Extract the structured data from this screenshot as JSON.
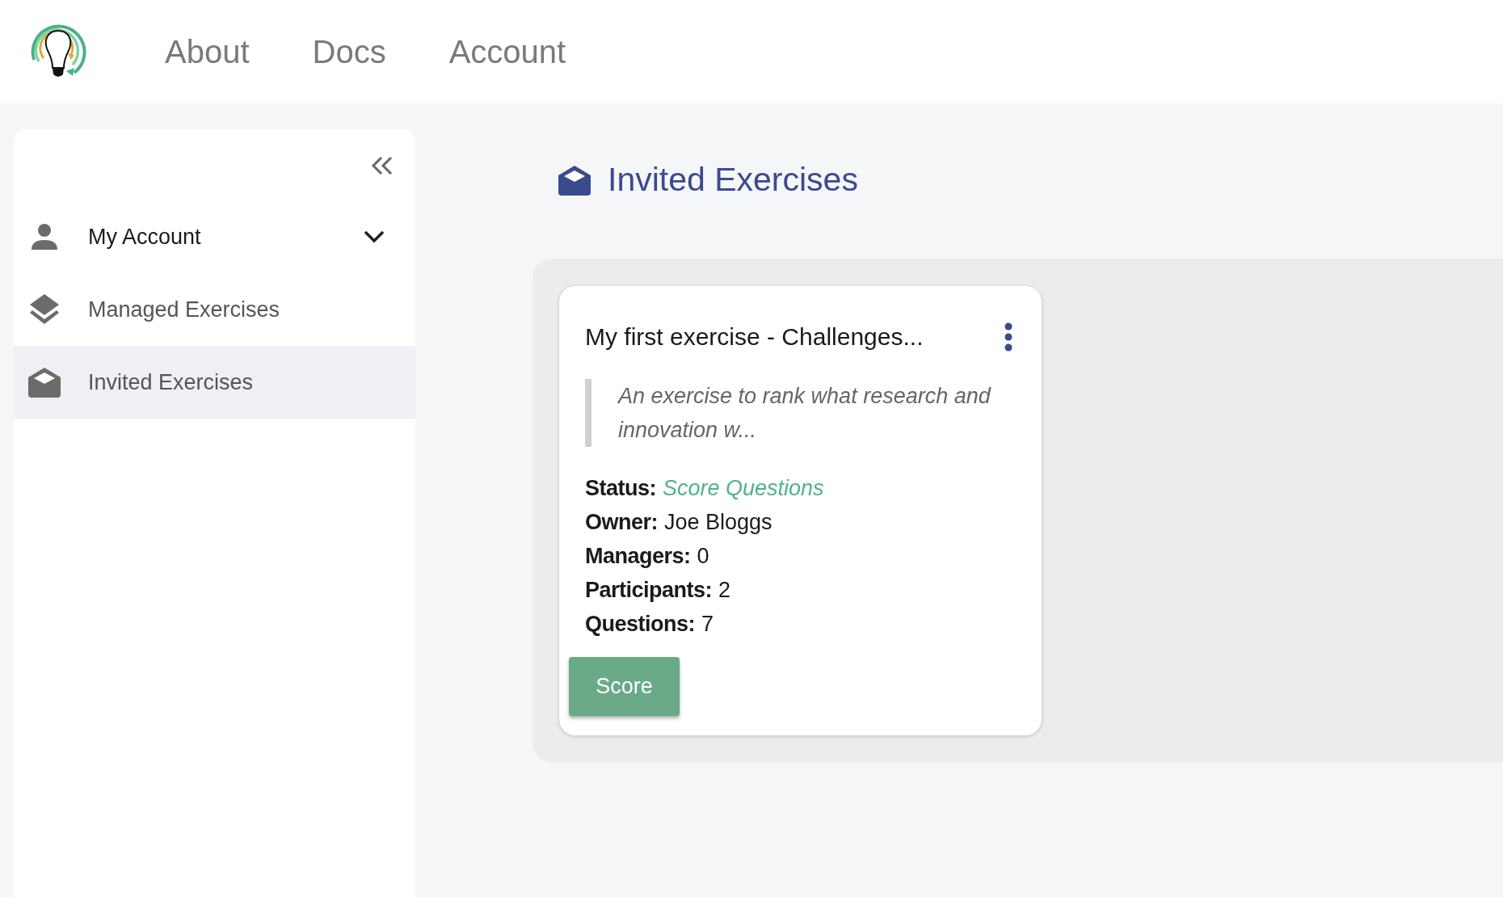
{
  "nav": [
    {
      "label": "About"
    },
    {
      "label": "Docs"
    },
    {
      "label": "Account"
    }
  ],
  "sidebar": {
    "items": [
      {
        "label": "My Account",
        "kind": "group",
        "expanded": false,
        "selected": false
      },
      {
        "label": "Managed Exercises",
        "kind": "link",
        "selected": false
      },
      {
        "label": "Invited Exercises",
        "kind": "link",
        "selected": true
      }
    ]
  },
  "page_title": "Invited Exercises",
  "cards": [
    {
      "title": "My first exercise - Challenges...",
      "description": "An exercise to rank what research and innovation w...",
      "details": [
        {
          "label": "Status:",
          "value": "Score Questions",
          "kind": "status"
        },
        {
          "label": "Owner:",
          "value": "Joe Bloggs",
          "kind": "plain"
        },
        {
          "label": "Managers:",
          "value": "0",
          "kind": "plain"
        },
        {
          "label": "Participants:",
          "value": "2",
          "kind": "plain"
        },
        {
          "label": "Questions:",
          "value": "7",
          "kind": "plain"
        }
      ],
      "button": "Score"
    }
  ]
}
